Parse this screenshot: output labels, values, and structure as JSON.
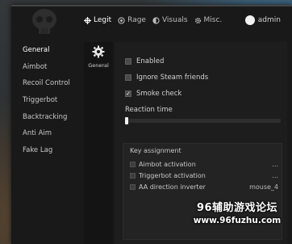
{
  "header": {
    "tabs": [
      {
        "label": "Legit",
        "icon": "crosshair-icon",
        "active": true
      },
      {
        "label": "Rage",
        "icon": "target-icon",
        "active": false
      },
      {
        "label": "Visuals",
        "icon": "half-circle-icon",
        "active": false
      },
      {
        "label": "Misc.",
        "icon": "gear-icon",
        "active": false
      }
    ],
    "user": {
      "name": "admin",
      "avatar": "avatar-circle"
    }
  },
  "sidebar": {
    "items": [
      {
        "label": "General",
        "active": true
      },
      {
        "label": "Aimbot",
        "active": false
      },
      {
        "label": "Recoil Control",
        "active": false
      },
      {
        "label": "Triggerbot",
        "active": false
      },
      {
        "label": "Backtracking",
        "active": false
      },
      {
        "label": "Anti Aim",
        "active": false
      },
      {
        "label": "Fake Lag",
        "active": false
      }
    ]
  },
  "subnav": {
    "items": [
      {
        "label": "General",
        "icon": "gear-icon"
      }
    ]
  },
  "settings": {
    "enabled": {
      "label": "Enabled",
      "checked": false
    },
    "ignore_steam": {
      "label": "Ignore Steam friends",
      "checked": false
    },
    "smoke_check": {
      "label": "Smoke check",
      "checked": true
    },
    "reaction_time": {
      "label": "Reaction time",
      "value_fraction": 0.0
    }
  },
  "key_assignment": {
    "title": "Key assignment",
    "rows": [
      {
        "label": "Aimbot activation",
        "value": "...",
        "checked": false
      },
      {
        "label": "Triggerbot activation",
        "value": "...",
        "checked": false
      },
      {
        "label": "AA direction inverter",
        "value": "mouse_4",
        "checked": false
      }
    ]
  },
  "watermark": {
    "line1": "96辅助游戏论坛",
    "line2": "www.96fuzhu.com"
  },
  "colors": {
    "window_bg": "#191919",
    "content_bg": "#1d1d1d",
    "text": "#d2d2d2"
  }
}
